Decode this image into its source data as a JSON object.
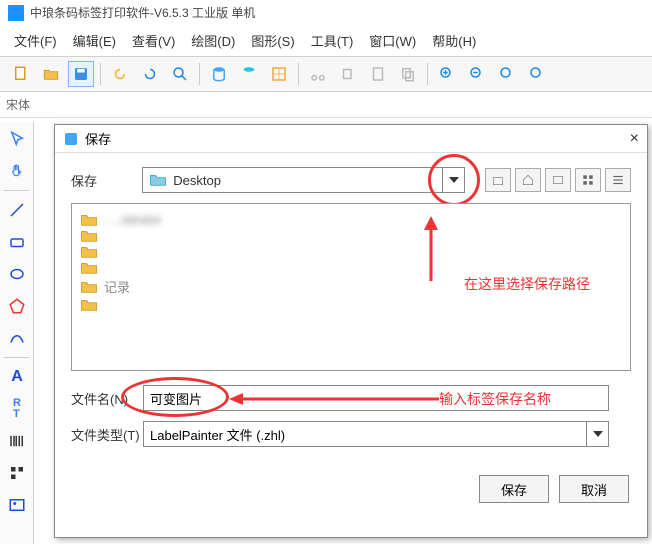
{
  "app": {
    "title": "中琅条码标签打印软件-V6.5.3 工业版 单机"
  },
  "menu": [
    "文件(F)",
    "编辑(E)",
    "查看(V)",
    "绘图(D)",
    "图形(S)",
    "工具(T)",
    "窗口(W)",
    "帮助(H)"
  ],
  "font_row": "宋体",
  "file_items": [
    ".  ...istrator",
    "",
    "",
    "",
    "            记录",
    ""
  ],
  "dialog": {
    "title": "保存",
    "save_label": "保存",
    "location": "Desktop",
    "filename_label": "文件名(N)",
    "filename_value": "可变图片",
    "type_label": "文件类型(T)",
    "type_value": "LabelPainter 文件 (.zhl)",
    "btn_save": "保存",
    "btn_cancel": "取消"
  },
  "annotations": {
    "hint_path": "在这里选择保存路径",
    "hint_name": "输入标签保存名称"
  }
}
